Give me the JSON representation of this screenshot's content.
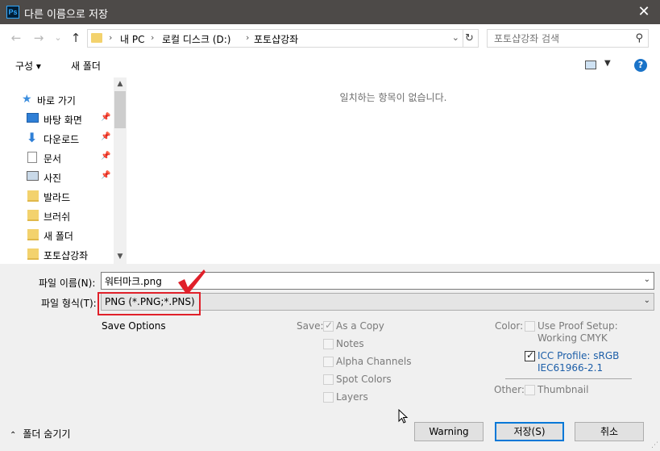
{
  "window": {
    "title": "다른 이름으로 저장",
    "app_badge": "Ps",
    "close": "✕"
  },
  "nav": {
    "back": "←",
    "forward": "→",
    "recent": "⌄",
    "up": "↑",
    "breadcrumb": [
      "내 PC",
      "로컬 디스크 (D:)",
      "포토샵강좌"
    ],
    "separator": "›",
    "refresh": "↻",
    "search_placeholder": "포토샵강좌 검색"
  },
  "toolbar": {
    "organize": "구성 ▾",
    "new_folder": "새 폴더",
    "help": "?"
  },
  "sidebar": {
    "items": [
      {
        "label": "바로 가기",
        "icon": "star-icon",
        "pinned": false
      },
      {
        "label": "바탕 화면",
        "icon": "desktop-icon",
        "pinned": true
      },
      {
        "label": "다운로드",
        "icon": "download-icon",
        "pinned": true
      },
      {
        "label": "문서",
        "icon": "document-icon",
        "pinned": true
      },
      {
        "label": "사진",
        "icon": "pictures-icon",
        "pinned": true
      },
      {
        "label": "발라드",
        "icon": "folder-icon",
        "pinned": false
      },
      {
        "label": "브러쉬",
        "icon": "folder-icon",
        "pinned": false
      },
      {
        "label": "새 폴더",
        "icon": "folder-icon",
        "pinned": false
      },
      {
        "label": "포토샵강좌",
        "icon": "folder-icon",
        "pinned": false
      }
    ]
  },
  "content": {
    "empty_message": "일치하는 항목이 없습니다."
  },
  "form": {
    "filename_label": "파일 이름(N):",
    "filename_value": "워터마크.png",
    "filetype_label": "파일 형식(T):",
    "filetype_value": "PNG (*.PNG;*.PNS)"
  },
  "options": {
    "save_options": "Save Options",
    "save_label": "Save:",
    "save_items": [
      {
        "label": "As a Copy",
        "checked": true
      },
      {
        "label": "Notes",
        "checked": false
      },
      {
        "label": "Alpha Channels",
        "checked": false
      },
      {
        "label": "Spot Colors",
        "checked": false
      },
      {
        "label": "Layers",
        "checked": false
      }
    ],
    "color_label": "Color:",
    "proof_line1": "Use Proof Setup:",
    "proof_line2": "Working CMYK",
    "icc_line1": "ICC Profile:  sRGB",
    "icc_line2": "IEC61966-2.1",
    "other_label": "Other:",
    "thumbnail": "Thumbnail"
  },
  "buttons": {
    "warning": "Warning",
    "save": "저장(S)",
    "cancel": "취소",
    "hide_folders": "폴더 숨기기"
  },
  "colors": {
    "titlebar": "#4d4a48",
    "highlight_red": "#e0202a",
    "accent_blue": "#0078d7"
  }
}
